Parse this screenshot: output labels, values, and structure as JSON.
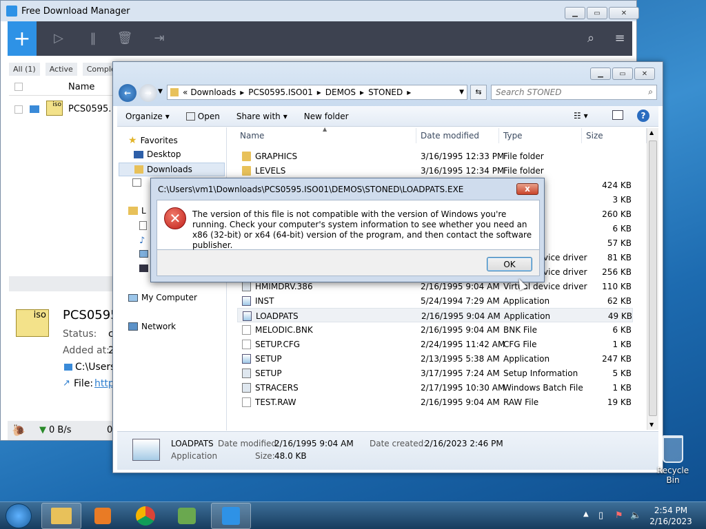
{
  "fdm": {
    "title": "Free Download Manager",
    "tabs": [
      "All (1)",
      "Active",
      "Comple"
    ],
    "col_name": "Name",
    "row_name": "PCS0595.",
    "iso_label": "iso",
    "detail_name": "PCS0595",
    "detail_status_label": "Status:",
    "detail_status_val": "c",
    "detail_added_label": "Added at:",
    "detail_added_val": "2",
    "detail_path": "C:\\Users",
    "detail_file_label": "File:",
    "detail_file_val": "https",
    "speed": "0 B/s",
    "speed2": "0"
  },
  "explorer": {
    "breadcrumb": [
      "«",
      "Downloads",
      "PCS0595.ISO01",
      "DEMOS",
      "STONED"
    ],
    "search_placeholder": "Search STONED",
    "cmd": {
      "organize": "Organize",
      "open": "Open",
      "share": "Share with",
      "newfolder": "New folder"
    },
    "nav": {
      "favorites": "Favorites",
      "desktop": "Desktop",
      "downloads": "Downloads",
      "lib": "L",
      "computer": "My Computer",
      "network": "Network"
    },
    "columns": {
      "name": "Name",
      "date": "Date modified",
      "type": "Type",
      "size": "Size"
    },
    "files": [
      {
        "name": "GRAPHICS",
        "date": "3/16/1995 12:33 PM",
        "type": "File folder",
        "size": "",
        "icon": "folder"
      },
      {
        "name": "LEVELS",
        "date": "3/16/1995 12:34 PM",
        "type": "File folder",
        "size": "",
        "icon": "folder"
      },
      {
        "name": "",
        "date": "",
        "type": "",
        "size": "424 KB",
        "icon": ""
      },
      {
        "name": "",
        "date": "",
        "type": "on sett...",
        "size": "3 KB",
        "icon": "doc"
      },
      {
        "name": "",
        "date": "",
        "type": "",
        "size": "260 KB",
        "icon": ""
      },
      {
        "name": "",
        "date": "",
        "type": "",
        "size": "6 KB",
        "icon": ""
      },
      {
        "name": "",
        "date": "",
        "type": "",
        "size": "57 KB",
        "icon": ""
      },
      {
        "name": "HMIDET.386",
        "date": "2/16/1995 9:04 AM",
        "type": "Virtual device driver",
        "size": "81 KB",
        "icon": "gear"
      },
      {
        "name": "HMIDRV.386",
        "date": "2/16/1995 9:04 AM",
        "type": "Virtual device driver",
        "size": "256 KB",
        "icon": "gear"
      },
      {
        "name": "HMIMDRV.386",
        "date": "2/16/1995 9:04 AM",
        "type": "Virtual device driver",
        "size": "110 KB",
        "icon": "gear"
      },
      {
        "name": "INST",
        "date": "5/24/1994 7:29 AM",
        "type": "Application",
        "size": "62 KB",
        "icon": "app"
      },
      {
        "name": "LOADPATS",
        "date": "2/16/1995 9:04 AM",
        "type": "Application",
        "size": "49 KB",
        "icon": "app"
      },
      {
        "name": "MELODIC.BNK",
        "date": "2/16/1995 9:04 AM",
        "type": "BNK File",
        "size": "6 KB",
        "icon": "doc"
      },
      {
        "name": "SETUP.CFG",
        "date": "2/24/1995 11:42 AM",
        "type": "CFG File",
        "size": "1 KB",
        "icon": "doc"
      },
      {
        "name": "SETUP",
        "date": "2/13/1995 5:38 AM",
        "type": "Application",
        "size": "247 KB",
        "icon": "app"
      },
      {
        "name": "SETUP",
        "date": "3/17/1995 7:24 AM",
        "type": "Setup Information",
        "size": "5 KB",
        "icon": "gear"
      },
      {
        "name": "STRACERS",
        "date": "2/17/1995 10:30 AM",
        "type": "Windows Batch File",
        "size": "1 KB",
        "icon": "gear"
      },
      {
        "name": "TEST.RAW",
        "date": "2/16/1995 9:04 AM",
        "type": "RAW File",
        "size": "19 KB",
        "icon": "doc"
      }
    ],
    "details": {
      "name": "LOADPATS",
      "type": "Application",
      "mod_label": "Date modified:",
      "mod_val": "2/16/1995 9:04 AM",
      "created_label": "Date created:",
      "created_val": "2/16/2023 2:46 PM",
      "size_label": "Size:",
      "size_val": "48.0 KB"
    }
  },
  "dialog": {
    "title": "C:\\Users\\vm1\\Downloads\\PCS0595.ISO01\\DEMOS\\STONED\\LOADPATS.EXE",
    "message": "The version of this file is not compatible with the version of Windows you're running. Check your computer's system information to see whether you need an x86 (32-bit) or x64 (64-bit) version of the program, and then contact the software publisher.",
    "ok": "OK",
    "close": "x"
  },
  "desktop": {
    "recycle": "Recycle Bin"
  },
  "taskbar": {
    "time": "2:54 PM",
    "date": "2/16/2023"
  }
}
